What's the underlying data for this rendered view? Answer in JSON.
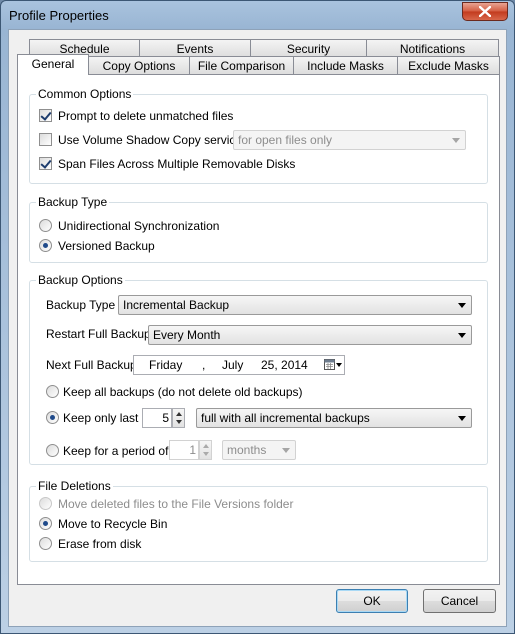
{
  "window": {
    "title": "Profile Properties"
  },
  "tabs_row1": [
    "Schedule",
    "Events",
    "Security",
    "Notifications"
  ],
  "tabs_row2": [
    "General",
    "Copy Options",
    "File Comparison",
    "Include Masks",
    "Exclude Masks"
  ],
  "active_tab": "General",
  "common_options": {
    "label": "Common Options",
    "prompt_delete": {
      "label": "Prompt to delete unmatched files",
      "checked": true
    },
    "vss": {
      "label": "Use Volume Shadow Copy service",
      "checked": false,
      "combo_value": "for open files only"
    },
    "span_disks": {
      "label": "Span Files Across Multiple Removable Disks",
      "checked": true
    }
  },
  "backup_type": {
    "label": "Backup Type",
    "unidirectional": "Unidirectional Synchronization",
    "versioned": "Versioned Backup",
    "selected": "versioned"
  },
  "backup_options": {
    "label": "Backup Options",
    "type_label": "Backup Type",
    "type_value": "Incremental Backup",
    "restart_label": "Restart Full Backup",
    "restart_value": "Every Month",
    "next_label": "Next Full Backup",
    "next_date": {
      "weekday": "Friday",
      "sep": ",",
      "month": "July",
      "day_year": "25, 2014"
    },
    "keep_all": "Keep all backups (do not delete old backups)",
    "keep_last": "Keep only last",
    "keep_last_value": "5",
    "keep_last_combo": "full with all incremental backups",
    "keep_period": "Keep for a period of",
    "keep_period_value": "1",
    "keep_period_unit": "months",
    "selected": "keep_last"
  },
  "file_deletions": {
    "label": "File Deletions",
    "move_versions": "Move deleted files to the File Versions folder",
    "recycle": "Move to Recycle Bin",
    "erase": "Erase from disk",
    "selected": "recycle"
  },
  "buttons": {
    "ok": "OK",
    "cancel": "Cancel"
  }
}
